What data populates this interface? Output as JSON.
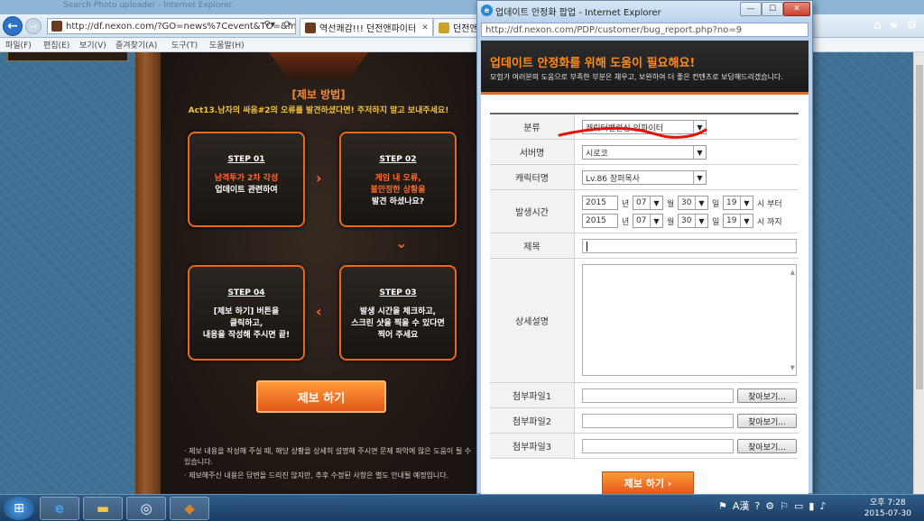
{
  "background_window": {
    "title": "Search Photo uploader - Internet Explorer",
    "url": "http://df.nexon.com/?GO=news%7Cevent&TO=&m",
    "tabs": [
      {
        "label": "역선쾌감!!! 던전앤파이터"
      },
      {
        "label": "던전앤"
      }
    ],
    "menu": [
      "파일(F)",
      "편집(E)",
      "보기(V)",
      "즐겨찾기(A)",
      "도구(T)",
      "도움말(H)"
    ]
  },
  "page": {
    "howto_title": "[제보 방법]",
    "howto_subtitle": "Act13.남자의 싸움#2의 오류를 발견하셨다면! 주저하지 말고 보내주세요!",
    "steps": [
      {
        "label": "STEP 01",
        "line1": "남격투가 2차 각성",
        "line2": "업데이트 관련하여",
        "line3": ""
      },
      {
        "label": "STEP 02",
        "line1": "게임 내 오류,",
        "line2": "불안정한 상황을",
        "line3": "발견 하셨나요?"
      },
      {
        "label": "STEP 03",
        "line1": "발생 시간을 체크하고,",
        "line2": "스크린 샷을 찍을 수 있다면",
        "line3": "찍어 주세요"
      },
      {
        "label": "STEP 04",
        "line1": "[제보 하기] 버튼을",
        "line2": "클릭하고,",
        "line3": "내용을 작성해 주시면 끝!"
      }
    ],
    "report_button": "제보 하기",
    "notes": [
      "· 제보 내용을 작성해 주실 때, 해당 상황을 상세히 설명해 주시면 문제 파악에 많은 도움이 될 수 있습니다.",
      "· 제보해주신 내용은 답변을 드리진 않지만, 추후 수정된 사항은 별도 안내될 예정입니다."
    ]
  },
  "popup": {
    "title": "업데이트 안정화 팝업 - Internet Explorer",
    "url": "http://df.nexon.com/PDP/customer/bug_report.php?no=9",
    "heading": "업데이트 안정화를 위해 도움이 필요해요!",
    "subheading": "모험가 여러분의 도움으로 부족한 부분은 채우고, 보완하여 더 좋은 컨텐츠로 보답해드리겠습니다.",
    "form": {
      "category_label": "분류",
      "category_value": "캐릭터밸런싱-인파이터",
      "server_label": "서버명",
      "server_value": "시로코",
      "character_label": "캐릭터명",
      "character_value": "Lv.86 장퍼목사",
      "time_label": "발생시간",
      "time_from": {
        "year": "2015",
        "year_unit": "년",
        "month": "07",
        "month_unit": "월",
        "day": "30",
        "day_unit": "일",
        "hour": "19",
        "hour_unit": "시 부터"
      },
      "time_to": {
        "year": "2015",
        "year_unit": "년",
        "month": "07",
        "month_unit": "월",
        "day": "30",
        "day_unit": "일",
        "hour": "19",
        "hour_unit": "시 까지"
      },
      "subject_label": "제목",
      "detail_label": "상세설명",
      "attach1_label": "첨부파일1",
      "attach2_label": "첨부파일2",
      "attach3_label": "첨부파일3",
      "browse_label": "찾아보기..."
    },
    "submit_label": "제보 하기  ›"
  },
  "taskbar": {
    "time": "오후 7:28",
    "date": "2015-07-30",
    "ime": "A漢"
  },
  "colors": {
    "accent_orange": "#e36a20",
    "annotation_red": "#e0140a"
  }
}
